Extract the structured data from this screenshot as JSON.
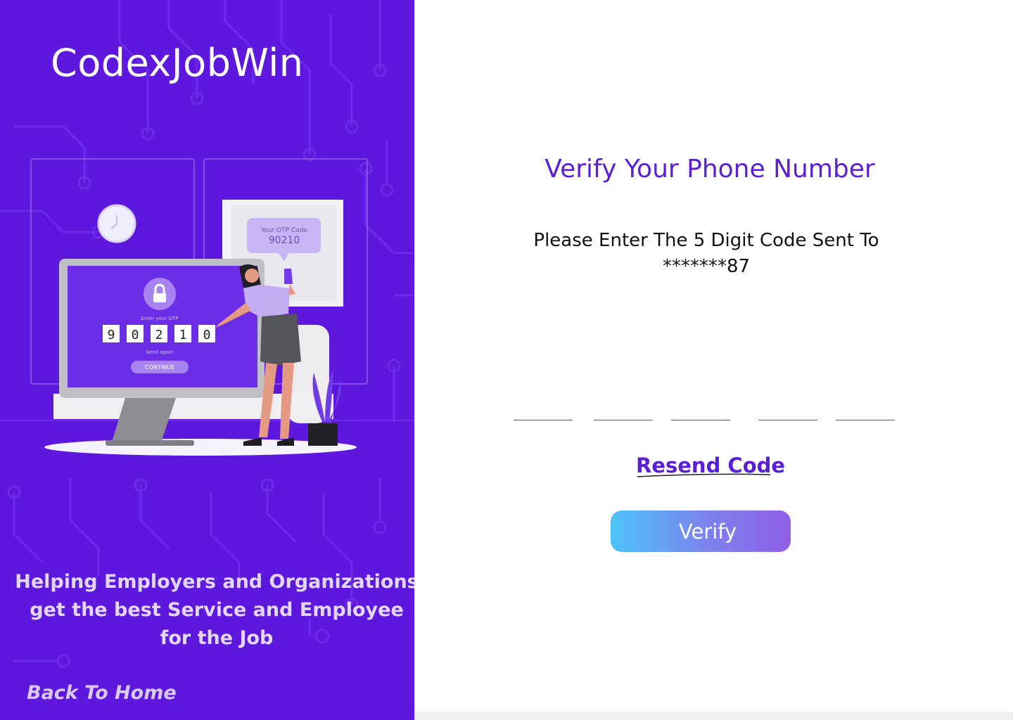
{
  "brand": {
    "name": "CodexJobWin"
  },
  "illustration": {
    "otp_bubble_label": "Your OTP Code",
    "otp_bubble_code": "90210",
    "screen_prompt": "Enter your OTP",
    "digits": [
      "9",
      "0",
      "2",
      "1",
      "0"
    ],
    "send_again": "Send again",
    "continue_label": "CONTINUE"
  },
  "left_panel": {
    "tagline_lines": [
      "Helping Employers and Organizations",
      "get the best Service and Employee",
      "for the Job"
    ],
    "back_home": "Back To Home"
  },
  "verify": {
    "title": "Verify Your Phone Number",
    "instruction_line1": "Please Enter The 5 Digit Code Sent To",
    "instruction_line2": "*******87",
    "otp_values": [
      "",
      "",
      "",
      "",
      ""
    ],
    "resend_label": "Resend Code",
    "verify_label": "Verify"
  },
  "colors": {
    "left_background": "#5d17dd",
    "accent": "#5b1ed6",
    "button_gradient_start": "#4ec3f8",
    "button_gradient_end": "#8f5fe6"
  }
}
